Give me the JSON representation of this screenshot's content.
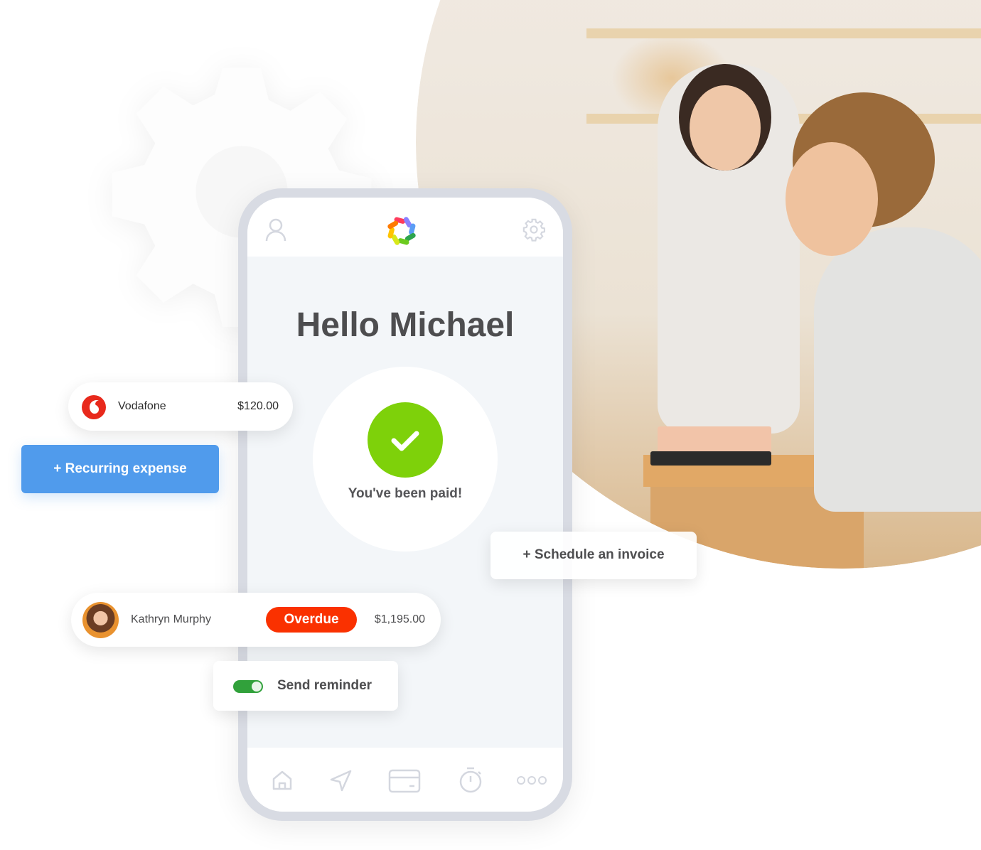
{
  "phone": {
    "greeting": "Hello Michael",
    "status_message": "You've been paid!",
    "logo_colors": [
      "#ff3b5c",
      "#8a80ff",
      "#5b9df5",
      "#2da44e",
      "#6ccb1f",
      "#d8e81a",
      "#ffc400",
      "#ff7a00"
    ],
    "top_icons": [
      "user-icon",
      "settings-gear-icon"
    ],
    "bottom_nav": [
      {
        "icon": "home-icon"
      },
      {
        "icon": "send-icon"
      },
      {
        "icon": "card-icon"
      },
      {
        "icon": "timer-icon"
      },
      {
        "icon": "more-icon"
      }
    ]
  },
  "expense_card": {
    "name": "Vodafone",
    "amount": "$120.00",
    "brand_color": "#e8291c"
  },
  "recurring_button": {
    "label": "+ Recurring expense",
    "color": "#509bec"
  },
  "schedule_button": {
    "label": "+ Schedule an invoice"
  },
  "invoice_card": {
    "name": "Kathryn Murphy",
    "status": "Overdue",
    "amount": "$1,195.00",
    "status_color": "#fa3100"
  },
  "reminder": {
    "label": "Send reminder",
    "enabled": true,
    "toggle_color": "#31a13b"
  }
}
